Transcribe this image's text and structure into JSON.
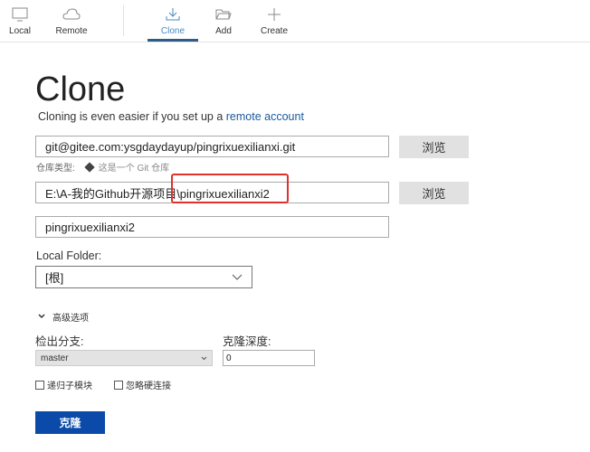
{
  "toolbar": {
    "items": [
      {
        "label": "Local",
        "icon": "monitor-icon"
      },
      {
        "label": "Remote",
        "icon": "cloud-icon"
      },
      {
        "label": "Clone",
        "icon": "download-icon",
        "active": true
      },
      {
        "label": "Add",
        "icon": "folder-icon"
      },
      {
        "label": "Create",
        "icon": "plus-icon"
      }
    ]
  },
  "main": {
    "title": "Clone",
    "subtitle": "Cloning is even easier if you set up a ",
    "subtitle_link": "remote account",
    "url_value": "git@gitee.com:ysgdaydayup/pingrixuexilianxi.git",
    "browse_label": "浏览",
    "repo_type_label": "仓库类型:",
    "repo_type_value": "这是一个 Git 仓库",
    "path_value": "E:\\A-我的Github开源项目\\pingrixuexilianxi2",
    "name_value": "pingrixuexilianxi2",
    "local_folder_label": "Local Folder:",
    "local_folder_value": "[根]",
    "advanced_label": "高级选项",
    "branch_label": "检出分支:",
    "branch_value": "master",
    "depth_label": "克隆深度:",
    "depth_value": "0",
    "recurse_label": "递归子模块",
    "ignore_label": "忽略硬连接",
    "clone_button": "克隆",
    "highlight_color": "#e0312b"
  }
}
